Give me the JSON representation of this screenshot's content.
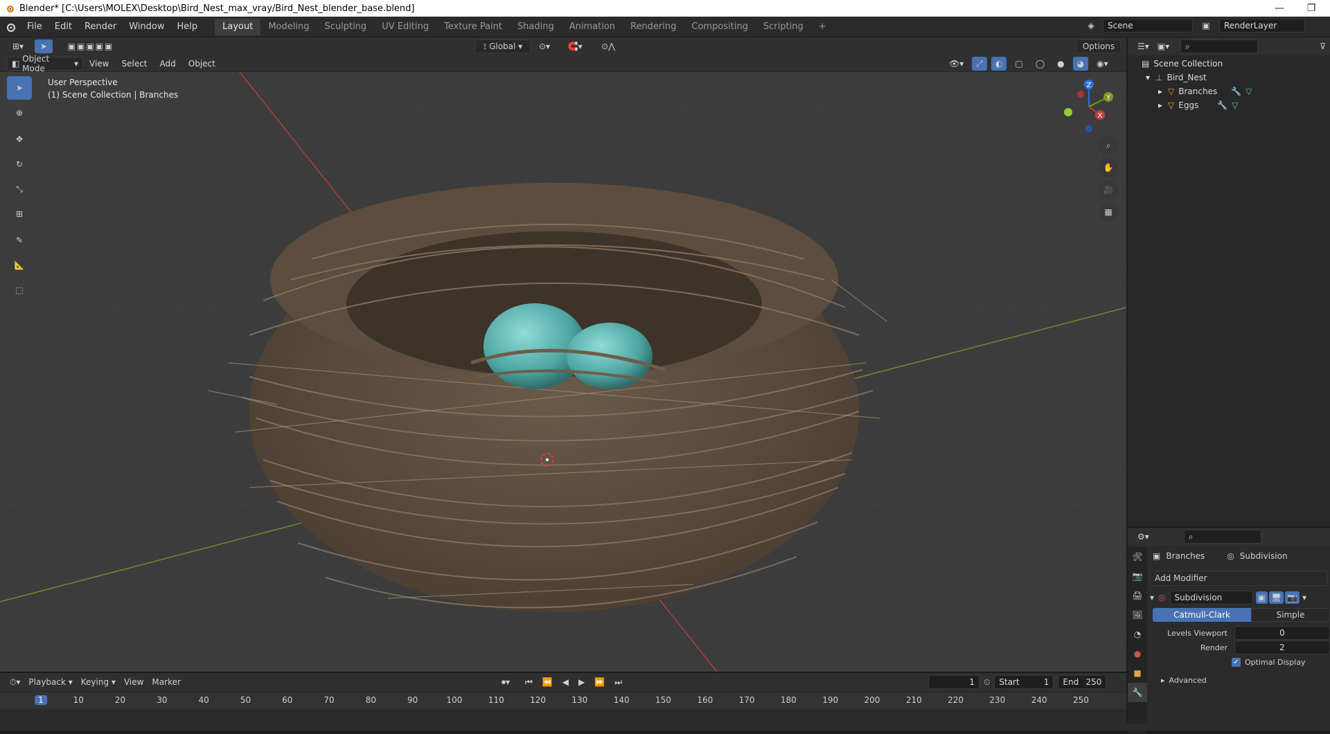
{
  "window": {
    "title": "Blender* [C:\\Users\\MOLEX\\Desktop\\Bird_Nest_max_vray/Bird_Nest_blender_base.blend]",
    "minimize": "—",
    "restore": "❐"
  },
  "menu": [
    "File",
    "Edit",
    "Render",
    "Window",
    "Help"
  ],
  "workspaces": [
    "Layout",
    "Modeling",
    "Sculpting",
    "UV Editing",
    "Texture Paint",
    "Shading",
    "Animation",
    "Rendering",
    "Compositing",
    "Scripting"
  ],
  "scene": {
    "label": "Scene",
    "render_layer": "RenderLayer"
  },
  "viewport_header": {
    "transform_orientation": "Global",
    "options": "Options",
    "mode": "Object Mode",
    "menus": [
      "View",
      "Select",
      "Add",
      "Object"
    ]
  },
  "viewport_overlay": {
    "perspective": "User Perspective",
    "collection": "(1) Scene Collection | Branches"
  },
  "gizmo": {
    "x": "X",
    "y": "Y",
    "z": "Z"
  },
  "outliner": {
    "root": "Scene Collection",
    "collection": "Bird_Nest",
    "objects": [
      "Branches",
      "Eggs"
    ]
  },
  "properties": {
    "object": "Branches",
    "modifier_crumb": "Subdivision",
    "add_modifier": "Add Modifier",
    "modifier_name": "Subdivision",
    "mode_catmull": "Catmull-Clark",
    "mode_simple": "Simple",
    "levels_viewport_label": "Levels Viewport",
    "levels_viewport": "0",
    "render_label": "Render",
    "render_value": "2",
    "optimal_display": "Optimal Display",
    "advanced": "Advanced"
  },
  "timeline": {
    "menus": [
      "Playback",
      "Keying",
      "View",
      "Marker"
    ],
    "current_frame": "1",
    "start_label": "Start",
    "start": "1",
    "end_label": "End",
    "end": "250",
    "ruler": [
      "1",
      "10",
      "20",
      "30",
      "40",
      "50",
      "60",
      "70",
      "80",
      "90",
      "100",
      "110",
      "120",
      "130",
      "140",
      "150",
      "160",
      "170",
      "180",
      "190",
      "200",
      "210",
      "220",
      "230",
      "240",
      "250"
    ]
  },
  "colors": {
    "accent": "#4772b3",
    "x_axis": "#c2413f",
    "y_axis": "#7a9a2a",
    "egg": "#5fb8b6"
  }
}
